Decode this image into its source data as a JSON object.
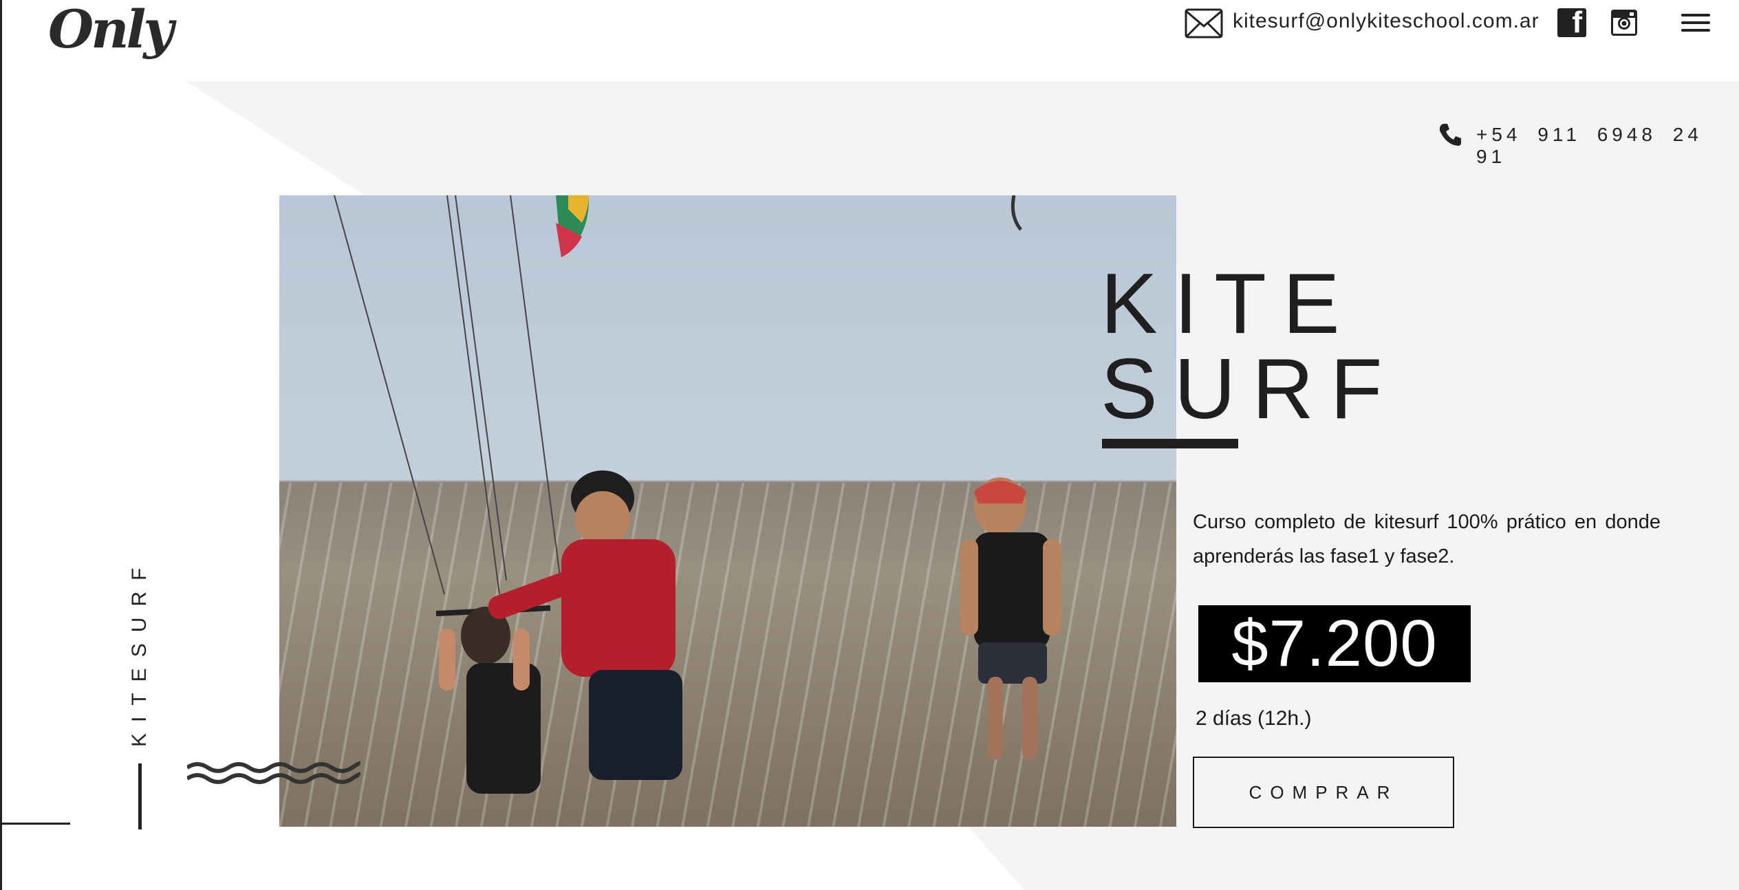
{
  "header": {
    "logo_text": "Only",
    "email": "kitesurf@onlykiteschool.com.ar",
    "social": {
      "facebook_icon": "facebook-icon",
      "instagram_icon": "instagram-icon"
    },
    "menu_icon": "hamburger-menu-icon",
    "phone": "+54 911 6948 24 91"
  },
  "hero": {
    "title_line1": "KITE",
    "title_line2": "SURF",
    "vertical_label": "KITESURF",
    "photo_alt": "kitesurf-lesson-photo",
    "description": "Curso completo de kitesurf 100% prático en donde aprenderás las fase1 y fase2.",
    "price": "$7.200",
    "duration": "2 días (12h.)",
    "buy_label": "COMPRAR"
  },
  "colors": {
    "text": "#1f1f1f",
    "price_bg": "#000000",
    "price_text": "#ffffff",
    "panel_bg": "#f4f4f4"
  }
}
